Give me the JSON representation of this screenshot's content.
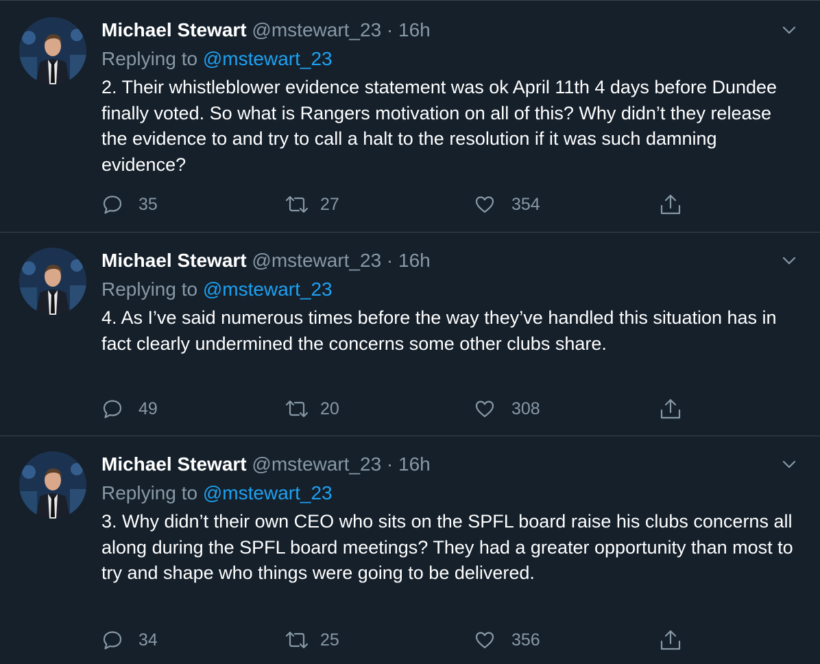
{
  "tweets": [
    {
      "author": "Michael Stewart",
      "handle": "@mstewart_23",
      "dot": "·",
      "time": "16h",
      "replying_prefix": "Replying to",
      "replying_to": "@mstewart_23",
      "text": "2. Their whistleblower evidence statement was ok April 11th 4 days before Dundee finally voted. So what is Rangers motivation on all of this? Why didn’t they release the evidence to and try to call a halt to the resolution if it was such damning evidence?",
      "replies": "35",
      "retweets": "27",
      "likes": "354"
    },
    {
      "author": "Michael Stewart",
      "handle": "@mstewart_23",
      "dot": "·",
      "time": "16h",
      "replying_prefix": "Replying to",
      "replying_to": "@mstewart_23",
      "text": "4. As I’ve said numerous times before the way they’ve handled this situation has in fact clearly undermined the concerns some other clubs share.",
      "replies": "49",
      "retweets": "20",
      "likes": "308"
    },
    {
      "author": "Michael Stewart",
      "handle": "@mstewart_23",
      "dot": "·",
      "time": "16h",
      "replying_prefix": "Replying to",
      "replying_to": "@mstewart_23",
      "text": "3. Why didn’t their own CEO who sits on the SPFL board raise his clubs concerns all along during the SPFL board meetings? They had a greater opportunity than most to try and shape who things were going to be delivered.",
      "replies": "34",
      "retweets": "25",
      "likes": "356"
    }
  ],
  "icons": {
    "avatar": "avatar-photo",
    "more": "chevron-down-icon",
    "reply": "reply-icon",
    "retweet": "retweet-icon",
    "like": "heart-icon",
    "share": "share-icon"
  },
  "colors": {
    "background": "#15202b",
    "text": "#ffffff",
    "secondary": "#8899a6",
    "link": "#1da1f2",
    "divider": "#38444d"
  }
}
